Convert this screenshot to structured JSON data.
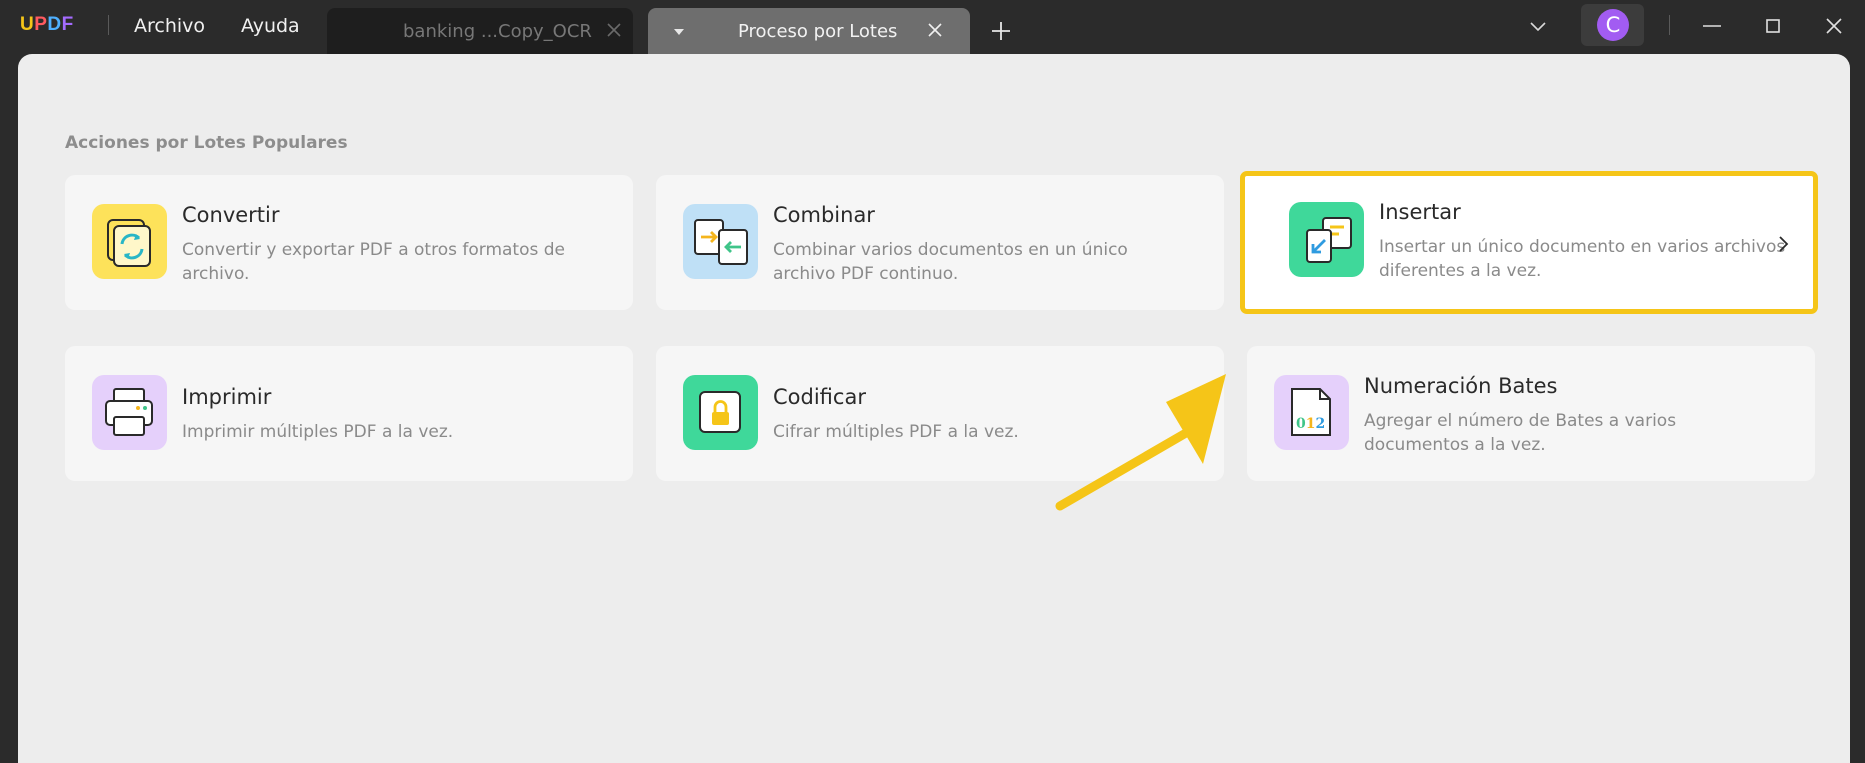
{
  "app": {
    "logo_letters": [
      "U",
      "P",
      "D",
      "F"
    ],
    "menu": [
      "Archivo",
      "Ayuda"
    ]
  },
  "tabs": [
    {
      "label": "banking ...Copy_OCR",
      "active": false
    },
    {
      "label": "Proceso por Lotes",
      "active": true
    }
  ],
  "user": {
    "avatar_initial": "C",
    "avatar_color": "#a25cf2"
  },
  "main": {
    "section_title": "Acciones por Lotes Populares",
    "cards": [
      {
        "title": "Convertir",
        "desc_line1": "Convertir y exportar PDF a otros formatos de",
        "desc_line2": "archivo.",
        "icon": "convert-icon",
        "icon_bg": "#fde25a"
      },
      {
        "title": "Combinar",
        "desc_line1": "Combinar varios documentos en un único",
        "desc_line2": "archivo PDF continuo.",
        "icon": "combine-icon",
        "icon_bg": "#bfe0f6"
      },
      {
        "title": "Insertar",
        "desc_line1": "Insertar un único documento en varios archivos",
        "desc_line2": "diferentes a la vez.",
        "icon": "insert-icon",
        "icon_bg": "#3fd89a",
        "highlighted": true
      },
      {
        "title": "Imprimir",
        "desc_line1": "Imprimir múltiples PDF a la vez.",
        "icon": "print-icon",
        "icon_bg": "#e5d0fb"
      },
      {
        "title": "Codificar",
        "desc_line1": "Cifrar múltiples PDF a la vez.",
        "icon": "lock-icon",
        "icon_bg": "#3fd89a"
      },
      {
        "title": "Numeración Bates",
        "desc_line1": "Agregar el número de Bates a varios",
        "desc_line2": "documentos a la vez.",
        "icon": "bates-icon",
        "icon_bg": "#e5d0fb",
        "icon_text": "012"
      }
    ]
  },
  "colors": {
    "highlight": "#f5c518",
    "annotation_arrow": "#f5c518"
  }
}
